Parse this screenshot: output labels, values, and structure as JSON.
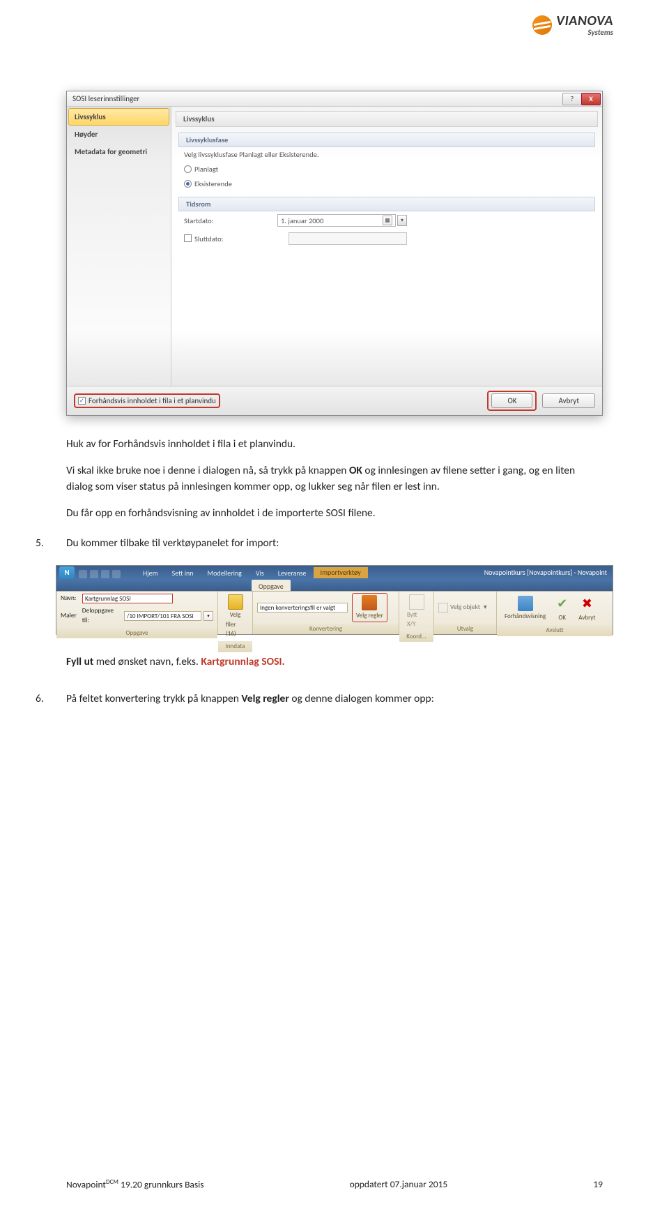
{
  "brand": {
    "name": "VIANOVA",
    "sub": "Systems"
  },
  "dialog": {
    "title": "SOSI leserinnstillinger",
    "tabs": [
      "Livssyklus",
      "Høyder",
      "Metadata for geometri"
    ],
    "panel_title": "Livssyklus",
    "section1": {
      "title": "Livssyklusfase",
      "hint": "Velg livssyklusfase Planlagt eller Eksisterende.",
      "opt1": "Planlagt",
      "opt2": "Eksisterende"
    },
    "section2": {
      "title": "Tidsrom",
      "start_label": "Startdato:",
      "start_value": "1.   januar   2000",
      "end_label": "Sluttdato:"
    },
    "preview_chk": "Forhåndsvis innholdet i fila i et planvindu",
    "ok": "OK",
    "cancel": "Avbryt"
  },
  "text": {
    "t1": "Huk av for Forhåndsvis innholdet i fila i et planvindu.",
    "t2a": "Vi skal ikke bruke noe i denne i dialogen nå, så trykk på knappen ",
    "t2b": "OK",
    "t2c": " og innlesingen av filene setter i gang, og en liten dialog som viser status på innlesingen kommer opp, og lukker seg når filen er lest inn.",
    "t3": "Du får opp en forhåndsvisning av innholdet i de importerte SOSI filene.",
    "n5": "5.",
    "t4": "Du kommer tilbake til verktøypanelet for import:",
    "t5a": "Fyll ut",
    "t5b": " med ønsket navn, f.eks. ",
    "t5c": "Kartgrunnlag SOSI.",
    "n6": "6.",
    "t6a": "På feltet konvertering trykk på knappen ",
    "t6b": "Velg regler",
    "t6c": " og denne dialogen kommer opp:"
  },
  "ribbon": {
    "ctx_group": "Importverktøy",
    "app_title": "Novapointkurs [Novapointkurs] - Novapoint",
    "tabs": {
      "hjem": "Hjem",
      "settinn": "Sett inn",
      "modellering": "Modellering",
      "vis": "Vis",
      "leveranse": "Leveranse",
      "oppgave": "Oppgave"
    },
    "g_oppgave": {
      "label": "Oppgave",
      "navn_lbl": "Navn:",
      "navn_val": "Kartgrunnlag SOSI",
      "maler_lbl": "Maler",
      "delopp_lbl": "Deloppgave til:",
      "delopp_val": "/10 IMPORT/101 FRA SOSI"
    },
    "g_inndata": {
      "label": "Inndata",
      "velg": "Velg",
      "filer": "filer (16)"
    },
    "g_konv": {
      "label": "Konvertering",
      "status": "Ingen konverteringsfil er valgt",
      "btn": "Velg regler"
    },
    "g_koord": {
      "label": "Koord...",
      "btn": "Bytt X/Y"
    },
    "g_utvalg": {
      "label": "Utvalg",
      "btn": "Velg objekt"
    },
    "g_avslutt": {
      "label": "Avslutt",
      "fh": "Forhåndsvisning",
      "ok": "OK",
      "avbryt": "Avbryt"
    }
  },
  "footer": {
    "left_a": "Novapoint",
    "left_sup": "DCM",
    "left_b": " 19.20 grunnkurs Basis",
    "center": "oppdatert 07.januar 2015",
    "right": "19"
  }
}
